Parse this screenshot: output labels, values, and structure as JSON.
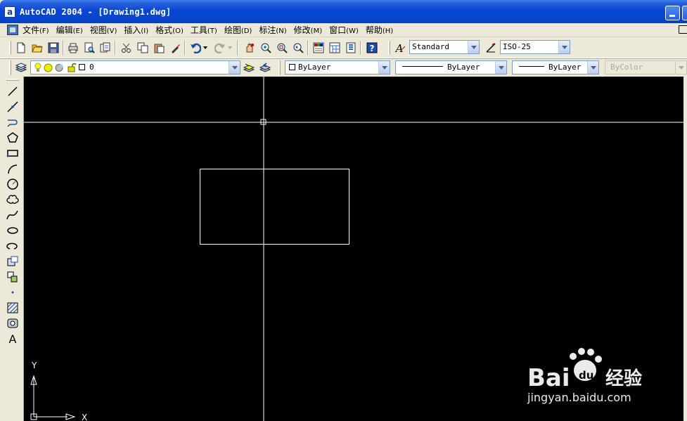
{
  "window": {
    "app_icon": "a",
    "title": "AutoCAD 2004 - [Drawing1.dwg]"
  },
  "menu": {
    "items": [
      {
        "label": "文件",
        "key": "(F)"
      },
      {
        "label": "编辑",
        "key": "(E)"
      },
      {
        "label": "视图",
        "key": "(V)"
      },
      {
        "label": "插入",
        "key": "(I)"
      },
      {
        "label": "格式",
        "key": "(O)"
      },
      {
        "label": "工具",
        "key": "(T)"
      },
      {
        "label": "绘图",
        "key": "(D)"
      },
      {
        "label": "标注",
        "key": "(N)"
      },
      {
        "label": "修改",
        "key": "(M)"
      },
      {
        "label": "窗口",
        "key": "(W)"
      },
      {
        "label": "帮助",
        "key": "(H)"
      }
    ]
  },
  "standard_toolbar": {
    "text_style": "Standard",
    "dim_style": "ISO-25"
  },
  "layers_toolbar": {
    "current_layer": "0",
    "color": "ByLayer",
    "linetype": "ByLayer",
    "lineweight": "ByLayer",
    "plot_style": "ByColor"
  },
  "ucs": {
    "y_label": "Y",
    "x_label": "X"
  },
  "watermark": {
    "brand": "Bai",
    "brand_suffix": "du",
    "product": "经验",
    "url": "jingyan.baidu.com"
  },
  "colors": {
    "canvas": "#000000",
    "drawing": "#ffffff",
    "titlebar": "#0a46d6"
  }
}
